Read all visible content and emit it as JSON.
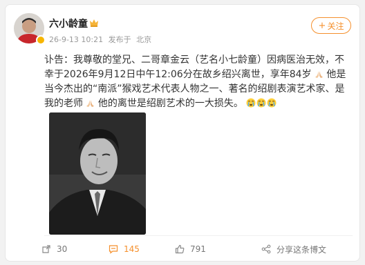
{
  "post": {
    "author": "六小龄童",
    "time": "26-9-13 10:21",
    "source_prefix": "发布于",
    "location": "北京",
    "follow_label": "关注",
    "text_part1": "讣告：我尊敬的堂兄、二哥章金云（艺名小七龄童）因病医治无效，不幸于2026年9月12日中午12:06分在故乡绍兴离世，享年84岁",
    "text_part2": "他是当今杰出的“南派”猴戏艺术代表人物之一、著名的绍剧表演艺术家、是我的老师",
    "text_part3": "他的离世是绍剧艺术的一大损失。",
    "icons": {
      "pray": "pray-icon",
      "cry": "crying-emoji-icon",
      "crown": "crown-icon",
      "verified": "verified-badge-icon"
    }
  },
  "actions": {
    "share_count": "30",
    "comment_count": "145",
    "like_count": "791",
    "share_to_friend": "分享这条博文"
  },
  "colors": {
    "accent": "#f58f2b",
    "text": "#333333",
    "muted": "#999999"
  }
}
